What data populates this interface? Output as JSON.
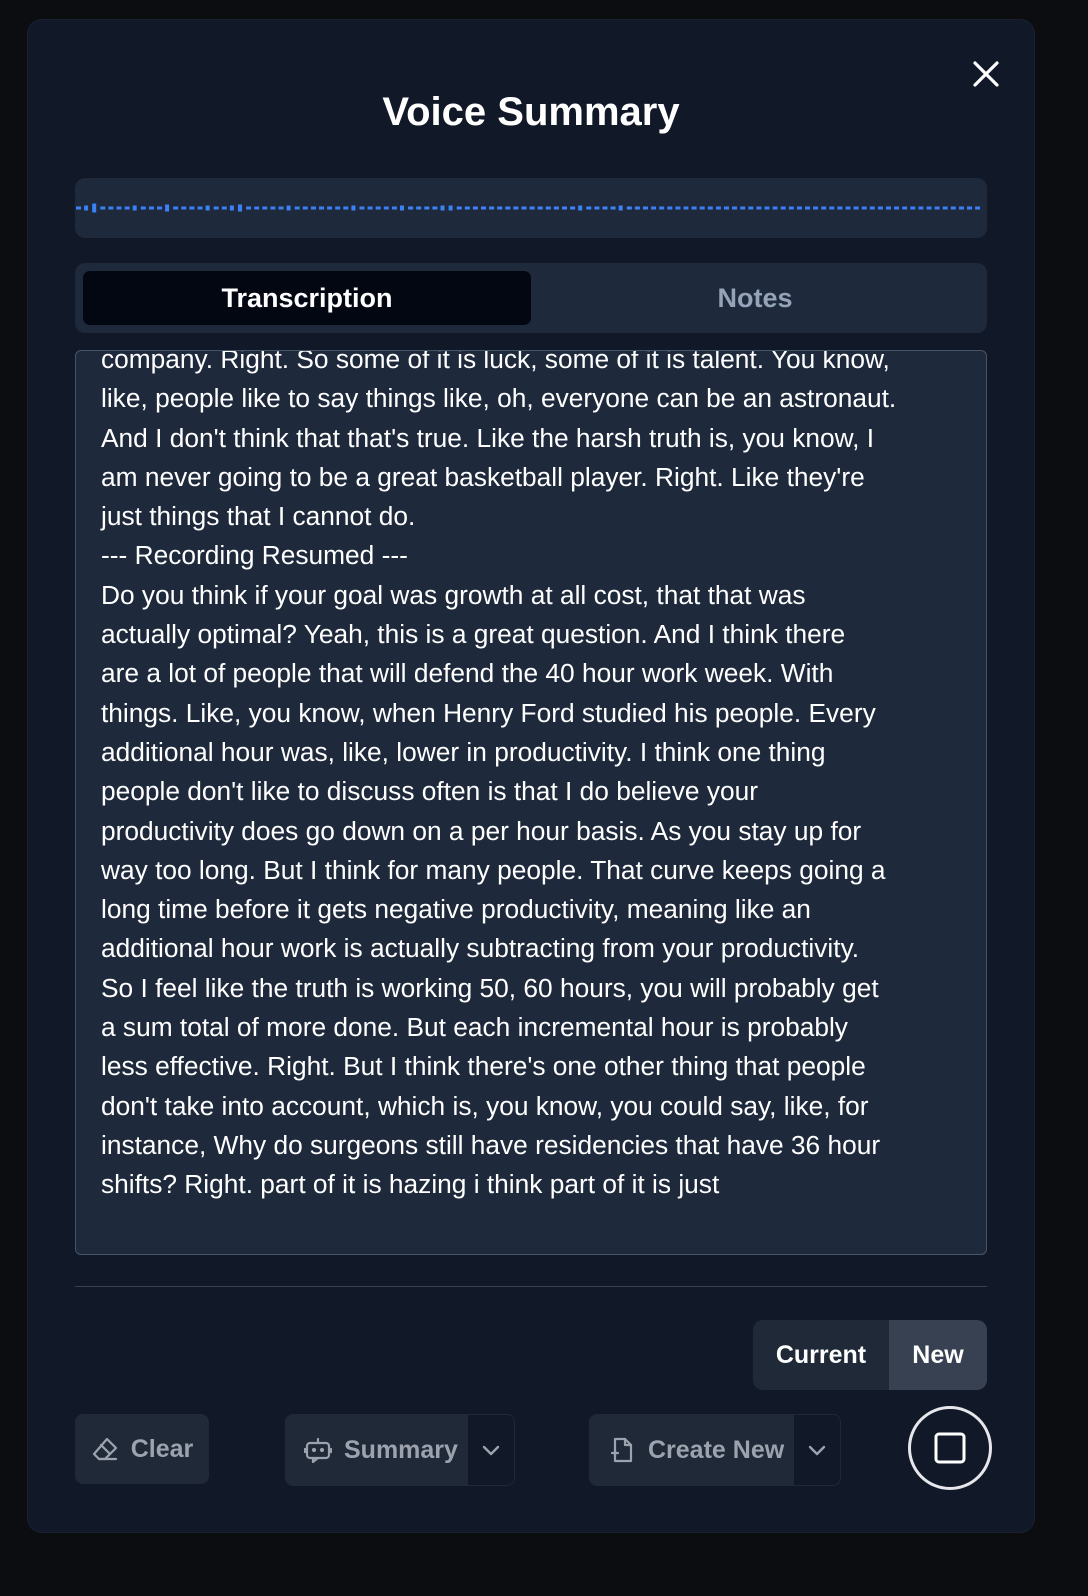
{
  "modal": {
    "title": "Voice Summary",
    "close_icon": "close-icon"
  },
  "waveform": {
    "color": "#3b82f6",
    "background": "#1e293b"
  },
  "tabs": [
    {
      "label": "Transcription",
      "active": true
    },
    {
      "label": "Notes",
      "active": false
    }
  ],
  "transcript": {
    "text": "company. Right. So some of it is luck, some of it is talent. You know,\nlike, people like to say things like, oh, everyone can be an astronaut.\nAnd I don't think that that's true. Like the harsh truth is, you know, I\nam never going to be a great basketball player. Right. Like they're\njust things that I cannot do.\n--- Recording Resumed ---\nDo you think if your goal was growth at all cost, that that was\nactually optimal? Yeah, this is a great question. And I think there\nare a lot of people that will defend the 40 hour work week. With\nthings. Like, you know, when Henry Ford studied his people. Every\nadditional hour was, like, lower in productivity. I think one thing\npeople don't like to discuss often is that I do believe your\nproductivity does go down on a per hour basis. As you stay up for\nway too long. But I think for many people. That curve keeps going a\nlong time before it gets negative productivity, meaning like an\nadditional hour work is actually subtracting from your productivity.\nSo I feel like the truth is working 50, 60 hours, you will probably get\na sum total of more done. But each incremental hour is probably\nless effective. Right. But I think there's one other thing that people\ndon't take into account, which is, you know, you could say, like, for\ninstance, Why do surgeons still have residencies that have 36 hour\nshifts? Right. part of it is hazing i think part of it is just"
  },
  "segment": {
    "current_label": "Current",
    "new_label": "New",
    "selected": "New"
  },
  "actions": {
    "clear_label": "Clear",
    "clear_icon": "eraser-icon",
    "summary_label": "Summary",
    "summary_icon": "chat-bot-icon",
    "create_label": "Create New",
    "create_icon": "file-plus-icon",
    "dropdown_icon": "chevron-down-icon",
    "stop_icon": "stop-icon"
  }
}
